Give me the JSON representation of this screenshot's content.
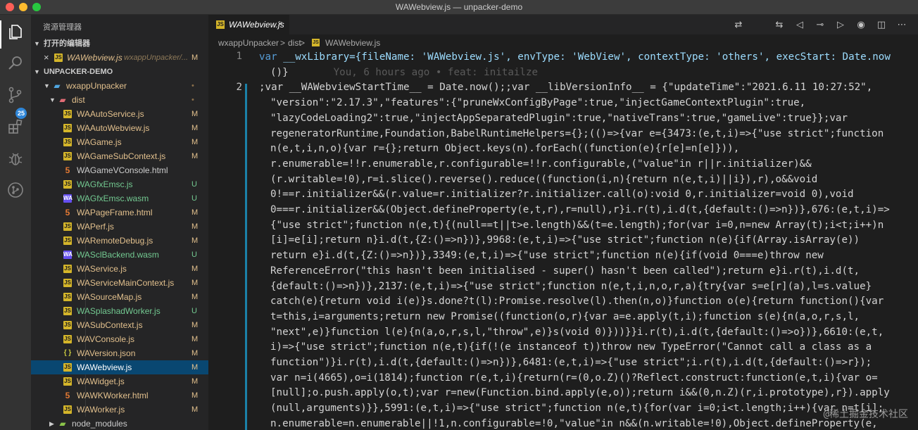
{
  "window": {
    "title": "WAWebview.js — unpacker-demo"
  },
  "activity_bar": {
    "scm_badge": "25"
  },
  "sidebar": {
    "title": "资源管理器",
    "open_editors_header": "打开的编辑器",
    "open_editor": {
      "name": "WAWebview.js",
      "path": "wxappUnpacker/...",
      "status": "M"
    },
    "project_header": "UNPACKER-DEMO",
    "tree": [
      {
        "name": "wxappUnpacker",
        "kind": "folder",
        "depth": 1,
        "status": "•"
      },
      {
        "name": "dist",
        "kind": "folder-red",
        "depth": 2,
        "status": "•"
      },
      {
        "name": "WAAutoService.js",
        "kind": "js",
        "depth": 3,
        "status": "M"
      },
      {
        "name": "WAAutoWebview.js",
        "kind": "js",
        "depth": 3,
        "status": "M"
      },
      {
        "name": "WAGame.js",
        "kind": "js",
        "depth": 3,
        "status": "M"
      },
      {
        "name": "WAGameSubContext.js",
        "kind": "js",
        "depth": 3,
        "status": "M"
      },
      {
        "name": "WAGameVConsole.html",
        "kind": "html",
        "depth": 3,
        "status": ""
      },
      {
        "name": "WAGfxEmsc.js",
        "kind": "js",
        "depth": 3,
        "status": "U"
      },
      {
        "name": "WAGfxEmsc.wasm",
        "kind": "wasm",
        "depth": 3,
        "status": "U"
      },
      {
        "name": "WAPageFrame.html",
        "kind": "html",
        "depth": 3,
        "status": "M"
      },
      {
        "name": "WAPerf.js",
        "kind": "js",
        "depth": 3,
        "status": "M"
      },
      {
        "name": "WARemoteDebug.js",
        "kind": "js",
        "depth": 3,
        "status": "M"
      },
      {
        "name": "WASclBackend.wasm",
        "kind": "wasm",
        "depth": 3,
        "status": "U"
      },
      {
        "name": "WAService.js",
        "kind": "js",
        "depth": 3,
        "status": "M"
      },
      {
        "name": "WAServiceMainContext.js",
        "kind": "js",
        "depth": 3,
        "status": "M"
      },
      {
        "name": "WASourceMap.js",
        "kind": "js",
        "depth": 3,
        "status": "M"
      },
      {
        "name": "WASplashadWorker.js",
        "kind": "js",
        "depth": 3,
        "status": "U"
      },
      {
        "name": "WASubContext.js",
        "kind": "js",
        "depth": 3,
        "status": "M"
      },
      {
        "name": "WAVConsole.js",
        "kind": "js",
        "depth": 3,
        "status": "M"
      },
      {
        "name": "WAVersion.json",
        "kind": "json",
        "depth": 3,
        "status": "M"
      },
      {
        "name": "WAWebview.js",
        "kind": "js",
        "depth": 3,
        "status": "M",
        "selected": true
      },
      {
        "name": "WAWidget.js",
        "kind": "js",
        "depth": 3,
        "status": "M"
      },
      {
        "name": "WAWKWorker.html",
        "kind": "html",
        "depth": 3,
        "status": "M"
      },
      {
        "name": "WAWorker.js",
        "kind": "js",
        "depth": 3,
        "status": "M"
      },
      {
        "name": "node_modules",
        "kind": "folder-green",
        "depth": 2,
        "status": ""
      }
    ]
  },
  "tab": {
    "label": "WAWebview.js",
    "close": "×"
  },
  "breadcrumb": {
    "part1": "wxappUnpacker",
    "sep": ">",
    "part2": "dist",
    "part3": "WAWebview.js"
  },
  "editor": {
    "line_numbers": [
      "1",
      "2"
    ],
    "line1_a": "var __wxLibrary={fileName: 'WAWebview.js', envType: 'WebView', contextType: 'others', execStart: Date.now",
    "line1_b": "()}",
    "blame": "You, 6 hours ago • feat: initailze",
    "line2": [
      ";var __WAWebviewStartTime__ = Date.now();;var __libVersionInfo__ = {\"updateTime\":\"2021.6.11 10:27:52\",",
      "\"version\":\"2.17.3\",\"features\":{\"pruneWxConfigByPage\":true,\"injectGameContextPlugin\":true,",
      "\"lazyCodeLoading2\":true,\"injectAppSeparatedPlugin\":true,\"nativeTrans\":true,\"gameLive\":true}};var",
      "regeneratorRuntime,Foundation,BabelRuntimeHelpers={};(()=>{var e={3473:(e,t,i)=>{\"use strict\";function",
      "n(e,t,i,n,o){var r={};return Object.keys(n).forEach((function(e){r[e]=n[e]})),",
      "r.enumerable=!!r.enumerable,r.configurable=!!r.configurable,(\"value\"in r||r.initializer)&&",
      "(r.writable=!0),r=i.slice().reverse().reduce((function(i,n){return n(e,t,i)||i}),r),o&&void",
      "0!==r.initializer&&(r.value=r.initializer?r.initializer.call(o):void 0,r.initializer=void 0),void",
      "0===r.initializer&&(Object.defineProperty(e,t,r),r=null),r}i.r(t),i.d(t,{default:()=>n})},676:(e,t,i)=>",
      "{\"use strict\";function n(e,t){(null==t||t>e.length)&&(t=e.length);for(var i=0,n=new Array(t);i<t;i++)n",
      "[i]=e[i];return n}i.d(t,{Z:()=>n})},9968:(e,t,i)=>{\"use strict\";function n(e){if(Array.isArray(e))",
      "return e}i.d(t,{Z:()=>n})},3349:(e,t,i)=>{\"use strict\";function n(e){if(void 0===e)throw new",
      "ReferenceError(\"this hasn't been initialised - super() hasn't been called\");return e}i.r(t),i.d(t,",
      "{default:()=>n})},2137:(e,t,i)=>{\"use strict\";function n(e,t,i,n,o,r,a){try{var s=e[r](a),l=s.value}",
      "catch(e){return void i(e)}s.done?t(l):Promise.resolve(l).then(n,o)}function o(e){return function(){var",
      "t=this,i=arguments;return new Promise((function(o,r){var a=e.apply(t,i);function s(e){n(a,o,r,s,l,",
      "\"next\",e)}function l(e){n(a,o,r,s,l,\"throw\",e)}s(void 0)}))}}i.r(t),i.d(t,{default:()=>o})},6610:(e,t,",
      "i)=>{\"use strict\";function n(e,t){if(!(e instanceof t))throw new TypeError(\"Cannot call a class as a",
      "function\")}i.r(t),i.d(t,{default:()=>n})},6481:(e,t,i)=>{\"use strict\";i.r(t),i.d(t,{default:()=>r});",
      "var n=i(4665),o=i(1814);function r(e,t,i){return(r=(0,o.Z)()?Reflect.construct:function(e,t,i){var o=",
      "[null];o.push.apply(o,t);var r=new(Function.bind.apply(e,o));return i&&(0,n.Z)(r,i.prototype),r}).apply",
      "(null,arguments)}},5991:(e,t,i)=>{\"use strict\";function n(e,t){for(var i=0;i<t.length;i++){var n=t[i];",
      "n.enumerable=n.enumerable||!1,n.configurable=!0,\"value\"in n&&(n.writable=!0),Object.defineProperty(e,"
    ]
  },
  "watermark": "@稀土掘金技术社区"
}
